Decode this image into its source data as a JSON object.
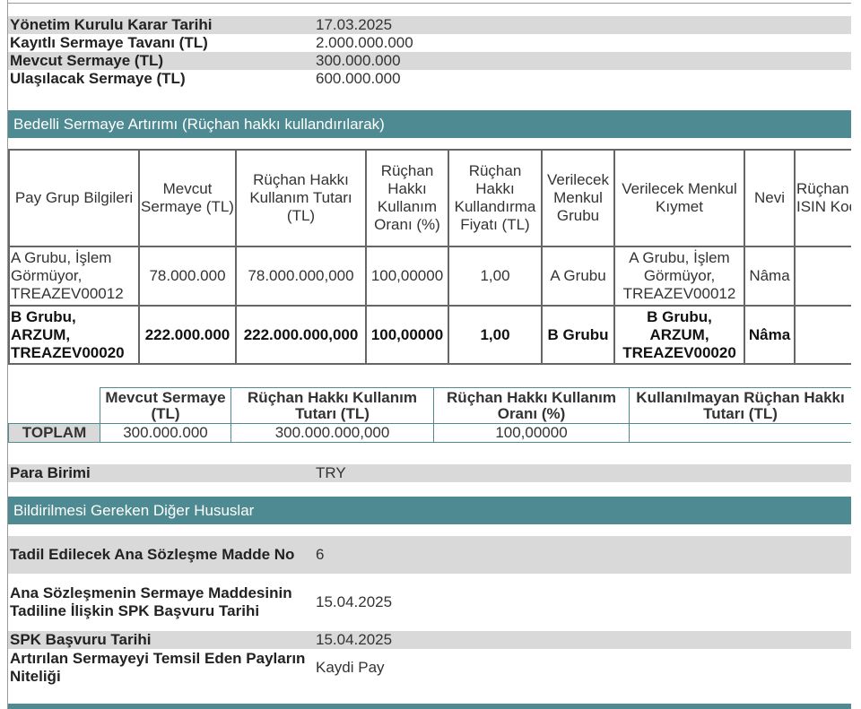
{
  "top_info": [
    {
      "label": "Yönetim Kurulu Karar Tarihi",
      "value": "17.03.2025"
    },
    {
      "label": "Kayıtlı Sermaye Tavanı (TL)",
      "value": "2.000.000.000"
    },
    {
      "label": "Mevcut Sermaye (TL)",
      "value": "300.000.000"
    },
    {
      "label": "Ulaşılacak Sermaye (TL)",
      "value": "600.000.000"
    }
  ],
  "section1_title": "Bedelli Sermaye Artırımı (Rüçhan hakkı kullandırılarak)",
  "main_table": {
    "headers": [
      "Pay Grup Bilgileri",
      "Mevcut Sermaye (TL)",
      "Rüçhan Hakkı Kullanım Tutarı (TL)",
      "Rüçhan Hakkı Kullanım Oranı (%)",
      "Rüçhan Hakkı Kullandırma Fiyatı (TL)",
      "Verilecek Menkul Grubu",
      "Verilecek Menkul Kıymet",
      "Nevi",
      "Rüçhan ISIN Kodu"
    ],
    "rows": [
      [
        "A Grubu, İşlem Görmüyor, TREAZEV00012",
        "78.000.000",
        "78.000.000,000",
        "100,00000",
        "1,00",
        "A Grubu",
        "A Grubu, İşlem Görmüyor, TREAZEV00012",
        "Nâma",
        ""
      ],
      [
        "B Grubu, ARZUM, TREAZEV00020",
        "222.000.000",
        "222.000.000,000",
        "100,00000",
        "1,00",
        "B Grubu",
        "B Grubu, ARZUM, TREAZEV00020",
        "Nâma",
        ""
      ]
    ]
  },
  "totals_table": {
    "headers": [
      "Mevcut Sermaye (TL)",
      "Rüçhan Hakkı Kullanım Tutarı (TL)",
      "Rüçhan Hakkı Kullanım Oranı (%)",
      "Kullanılmayan Rüçhan Hakkı Tutarı (TL)"
    ],
    "row_label": "TOPLAM",
    "values": [
      "300.000.000",
      "300.000.000,000",
      "100,00000",
      ""
    ]
  },
  "currency": {
    "label": "Para Birimi",
    "value": "TRY"
  },
  "section2_title": "Bildirilmesi Gereken Diğer Hususlar",
  "other_info": [
    {
      "label": "Tadil Edilecek Ana Sözleşme Madde No",
      "value": "6"
    },
    {
      "label": "Ana Sözleşmenin Sermaye Maddesinin Tadiline İlişkin SPK Başvuru Tarihi",
      "value": "15.04.2025"
    },
    {
      "label": "SPK Başvuru Tarihi",
      "value": "15.04.2025"
    },
    {
      "label": "Artırılan Sermayeyi Temsil Eden Payların Niteliği",
      "value": "Kaydi Pay"
    }
  ],
  "colors": {
    "section_bar": "#4e8a91",
    "row_shade": "#d9d9d9"
  }
}
